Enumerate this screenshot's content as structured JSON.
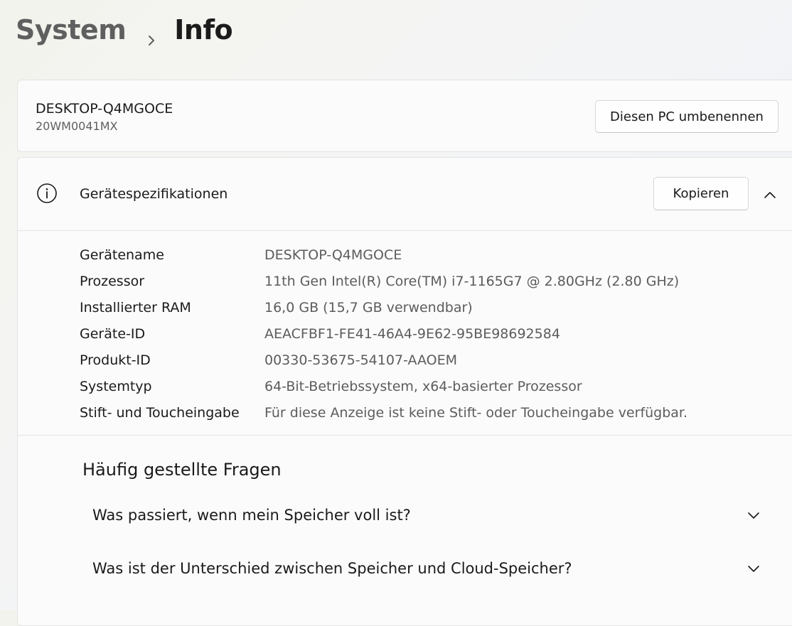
{
  "breadcrumb": {
    "parent": "System",
    "current": "Info"
  },
  "pc": {
    "name": "DESKTOP-Q4MGOCE",
    "model": "20WM0041MX",
    "rename_label": "Diesen PC umbenennen"
  },
  "specs": {
    "title": "Gerätespezifikationen",
    "copy_label": "Kopieren",
    "rows": [
      {
        "label": "Gerätename",
        "value": "DESKTOP-Q4MGOCE"
      },
      {
        "label": "Prozessor",
        "value": "11th Gen Intel(R) Core(TM) i7-1165G7 @ 2.80GHz (2.80 GHz)"
      },
      {
        "label": "Installierter RAM",
        "value": "16,0 GB (15,7 GB verwendbar)"
      },
      {
        "label": "Geräte-ID",
        "value": "AEACFBF1-FE41-46A4-9E62-95BE98692584"
      },
      {
        "label": "Produkt-ID",
        "value": "00330-53675-54107-AAOEM"
      },
      {
        "label": "Systemtyp",
        "value": "64-Bit-Betriebssystem, x64-basierter Prozessor"
      },
      {
        "label": "Stift- und Toucheingabe",
        "value": "Für diese Anzeige ist keine Stift- oder Toucheingabe verfügbar."
      }
    ]
  },
  "faq": {
    "title": "Häufig gestellte Fragen",
    "items": [
      {
        "question": "Was passiert, wenn mein Speicher voll ist?"
      },
      {
        "question": "Was ist der Unterschied zwischen Speicher und Cloud-Speicher?"
      }
    ]
  },
  "icons": {
    "breadcrumb_separator": "chevron-right-icon",
    "specs": "info-icon",
    "collapse": "chevron-up-icon",
    "faq_expand": "chevron-down-icon"
  }
}
